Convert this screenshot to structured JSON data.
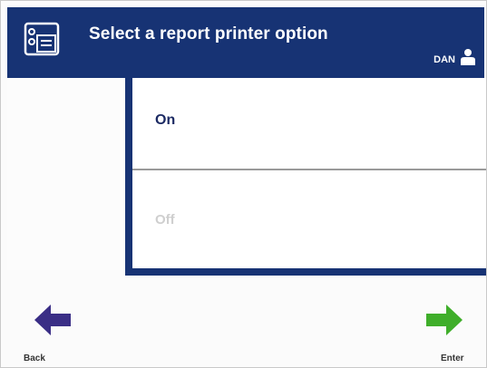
{
  "header": {
    "title": "Select a report printer option",
    "user": "DAN",
    "printer_icon": "printer-settings-icon",
    "user_icon": "user-icon"
  },
  "options": [
    {
      "label": "On",
      "state": "enabled"
    },
    {
      "label": "Off",
      "state": "disabled"
    }
  ],
  "nav": {
    "back_label": "Back",
    "back_icon": "arrow-left-icon",
    "enter_label": "Enter",
    "enter_icon": "arrow-right-icon"
  },
  "colors": {
    "header_bg": "#173374",
    "back_arrow": "#3a2e86",
    "enter_arrow": "#3fae2a",
    "disabled_text": "#cfcfcf"
  }
}
